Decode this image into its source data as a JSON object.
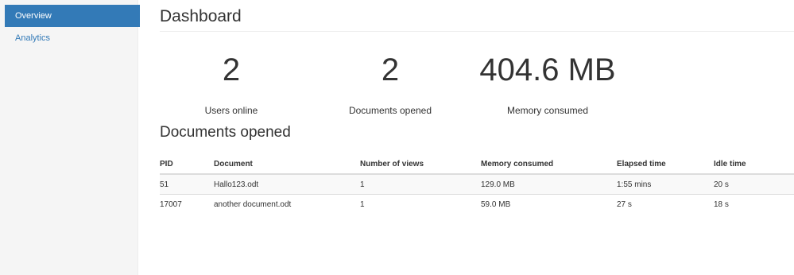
{
  "sidebar": {
    "items": [
      {
        "label": "Overview",
        "active": true
      },
      {
        "label": "Analytics",
        "active": false
      }
    ]
  },
  "header": {
    "title": "Dashboard"
  },
  "stats": [
    {
      "value": "2",
      "label": "Users online"
    },
    {
      "value": "2",
      "label": "Documents opened"
    },
    {
      "value": "404.6 MB",
      "label": "Memory consumed"
    }
  ],
  "documents": {
    "title": "Documents opened",
    "columns": [
      "PID",
      "Document",
      "Number of views",
      "Memory consumed",
      "Elapsed time",
      "Idle time"
    ],
    "rows": [
      [
        "51",
        "Hallo123.odt",
        "1",
        "129.0 MB",
        "1:55 mins",
        "20 s"
      ],
      [
        "17007",
        "another document.odt",
        "1",
        "59.0 MB",
        "27 s",
        "18 s"
      ]
    ]
  },
  "colors": {
    "accent": "#337ab7",
    "sidebar_bg": "#f5f5f5"
  }
}
